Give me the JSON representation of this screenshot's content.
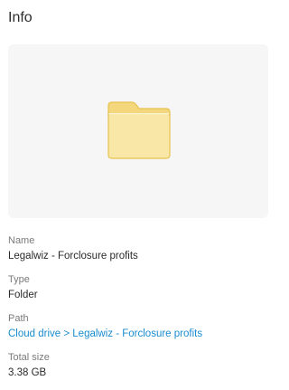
{
  "panel": {
    "title": "Info"
  },
  "preview": {
    "icon": "folder-icon",
    "colors": {
      "folder_fill": "#f8e7a7",
      "folder_tab": "#f4d77d",
      "folder_stroke": "#e7c24f",
      "preview_bg": "#f6f6f6"
    }
  },
  "details": {
    "name_label": "Name",
    "name_value": "Legalwiz - Forclosure profits",
    "type_label": "Type",
    "type_value": "Folder",
    "path_label": "Path",
    "path_value": "Cloud drive > Legalwiz - Forclosure profits",
    "size_label": "Total size",
    "size_value": "3.38 GB"
  },
  "colors": {
    "link": "#1a8ccf",
    "label": "#7a7a7a",
    "text": "#2b2b2b"
  }
}
